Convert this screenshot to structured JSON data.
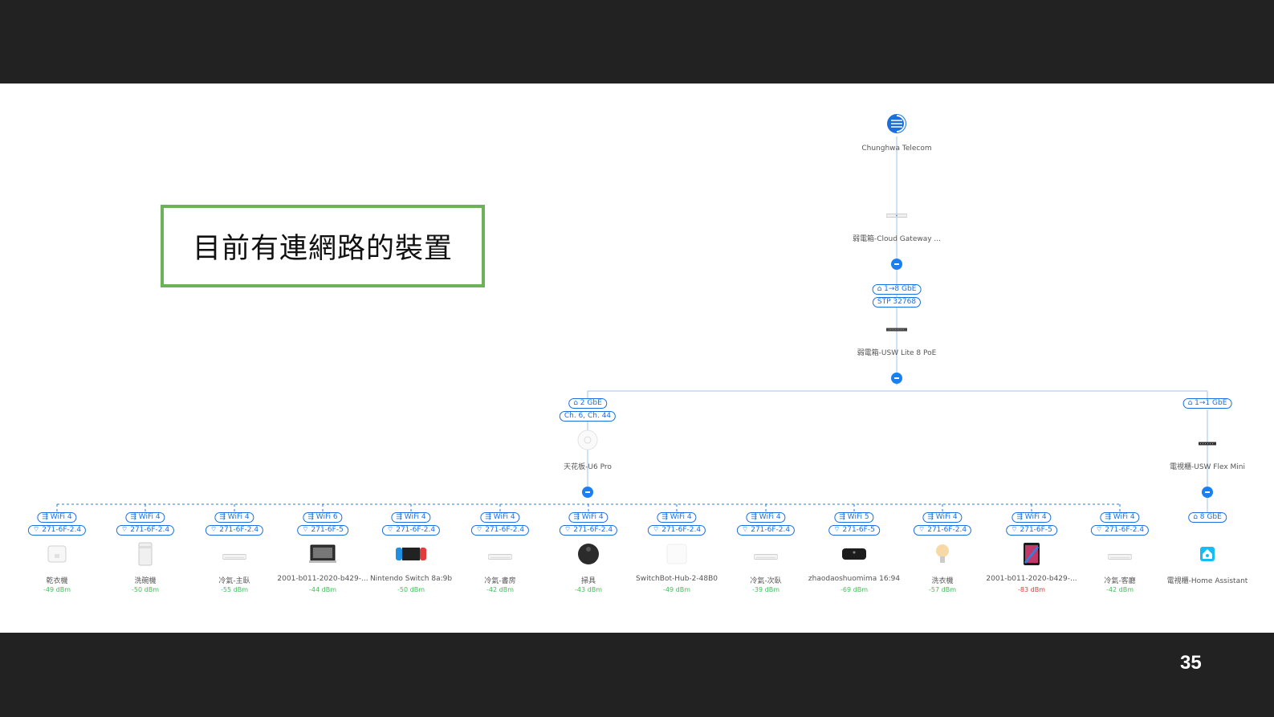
{
  "page_number": "35",
  "title_box": {
    "text": "目前有連網路的裝置"
  },
  "colors": {
    "accent": "#1a7ff0",
    "good_signal": "#3fbf5a",
    "bad_signal": "#e23b3b",
    "title_border": "#6db158"
  },
  "topology": {
    "isp": {
      "label": "Chunghwa Telecom",
      "icon": "chunghwa-logo-icon"
    },
    "gateway": {
      "label": "弱電箱-Cloud Gateway ...",
      "icon": "gateway-icon"
    },
    "gateway_link": {
      "port": "1→8 GbE",
      "stp": "STP 32768"
    },
    "switch": {
      "label": "弱電箱-USW Lite 8 PoE",
      "icon": "switch-icon"
    },
    "ap": {
      "label": "天花板-U6 Pro",
      "port": "2 GbE",
      "channels": "Ch. 6, Ch. 44",
      "icon": "access-point-icon"
    },
    "flex": {
      "label": "電視櫃-USW Flex Mini",
      "port": "1→1 GbE",
      "icon": "mini-switch-icon"
    },
    "clients": [
      {
        "wifi": "WiFi 4",
        "ssid": "271-6F-2.4",
        "name": "乾衣機",
        "signal": "-49 dBm",
        "bad": false,
        "icon": "dryer-icon"
      },
      {
        "wifi": "WiFi 4",
        "ssid": "271-6F-2.4",
        "name": "洗碗機",
        "signal": "-50 dBm",
        "bad": false,
        "icon": "dishwasher-icon"
      },
      {
        "wifi": "WiFi 4",
        "ssid": "271-6F-2.4",
        "name": "冷氣-主臥",
        "signal": "-55 dBm",
        "bad": false,
        "icon": "air-conditioner-icon"
      },
      {
        "wifi": "WiFi 6",
        "ssid": "271-6F-5",
        "name": "2001-b011-2020-b429-...",
        "signal": "-44 dBm",
        "bad": false,
        "icon": "laptop-icon"
      },
      {
        "wifi": "WiFi 4",
        "ssid": "271-6F-2.4",
        "name": "Nintendo Switch 8a:9b",
        "signal": "-50 dBm",
        "bad": false,
        "icon": "game-console-icon"
      },
      {
        "wifi": "WiFi 4",
        "ssid": "271-6F-2.4",
        "name": "冷氣-書房",
        "signal": "-42 dBm",
        "bad": false,
        "icon": "air-conditioner-icon"
      },
      {
        "wifi": "WiFi 4",
        "ssid": "271-6F-2.4",
        "name": "掃具",
        "signal": "-43 dBm",
        "bad": false,
        "icon": "robot-vacuum-icon"
      },
      {
        "wifi": "WiFi 4",
        "ssid": "271-6F-2.4",
        "name": "SwitchBot-Hub-2-48B0",
        "signal": "-49 dBm",
        "bad": false,
        "icon": "smart-hub-icon"
      },
      {
        "wifi": "WiFi 4",
        "ssid": "271-6F-2.4",
        "name": "冷氣-次臥",
        "signal": "-39 dBm",
        "bad": false,
        "icon": "air-conditioner-icon"
      },
      {
        "wifi": "WiFi 5",
        "ssid": "271-6F-5",
        "name": "zhaodaoshuomima 16:94",
        "signal": "-69 dBm",
        "bad": false,
        "icon": "apple-tv-icon"
      },
      {
        "wifi": "WiFi 4",
        "ssid": "271-6F-2.4",
        "name": "洗衣機",
        "signal": "-57 dBm",
        "bad": false,
        "icon": "light-bulb-icon"
      },
      {
        "wifi": "WiFi 4",
        "ssid": "271-6F-5",
        "name": "2001-b011-2020-b429-...",
        "signal": "-83 dBm",
        "bad": true,
        "icon": "tablet-icon"
      },
      {
        "wifi": "WiFi 4",
        "ssid": "271-6F-2.4",
        "name": "冷氣-客廳",
        "signal": "-42 dBm",
        "bad": false,
        "icon": "air-conditioner-icon"
      }
    ],
    "wired_client": {
      "port": "8 GbE",
      "name": "電視櫃-Home Assistant",
      "icon": "home-assistant-icon"
    }
  }
}
